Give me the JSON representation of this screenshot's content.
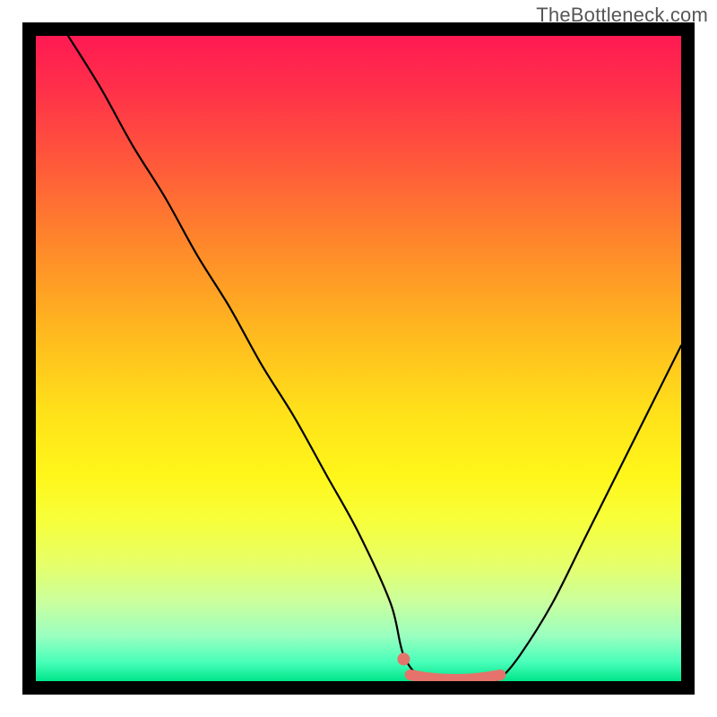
{
  "watermark": "TheBottleneck.com",
  "colors": {
    "frame": "#000000",
    "gradient_top": "#ff1a53",
    "gradient_mid": "#ffe01a",
    "gradient_bottom": "#00e589",
    "curve": "#000000",
    "highlight": "#e5736b",
    "watermark_text": "#565656"
  },
  "chart_data": {
    "type": "line",
    "title": "",
    "xlabel": "",
    "ylabel": "",
    "xlim": [
      0,
      100
    ],
    "ylim": [
      0,
      100
    ],
    "x": [
      5,
      10,
      15,
      20,
      25,
      30,
      35,
      40,
      45,
      50,
      55,
      57,
      60,
      65,
      70,
      72,
      75,
      80,
      85,
      90,
      95,
      100
    ],
    "y": [
      100,
      92,
      83,
      75,
      66,
      58,
      49,
      41,
      32,
      23,
      12,
      4,
      0.5,
      0,
      0,
      0.5,
      4,
      12,
      22,
      32,
      42,
      52
    ],
    "annotations": [
      {
        "kind": "flat_region_highlight",
        "x_start": 58,
        "x_end": 72,
        "y": 0
      },
      {
        "kind": "marker_dot",
        "x": 57,
        "y": 3
      }
    ],
    "notes": "Bottleneck curve: steep descent from top-left to a flat minimum near x≈60–72, then moderate rise toward upper-right. Background is a vertical red→yellow→green gradient indicating bottleneck severity (red high, green low). No visible axis ticks or labels."
  }
}
